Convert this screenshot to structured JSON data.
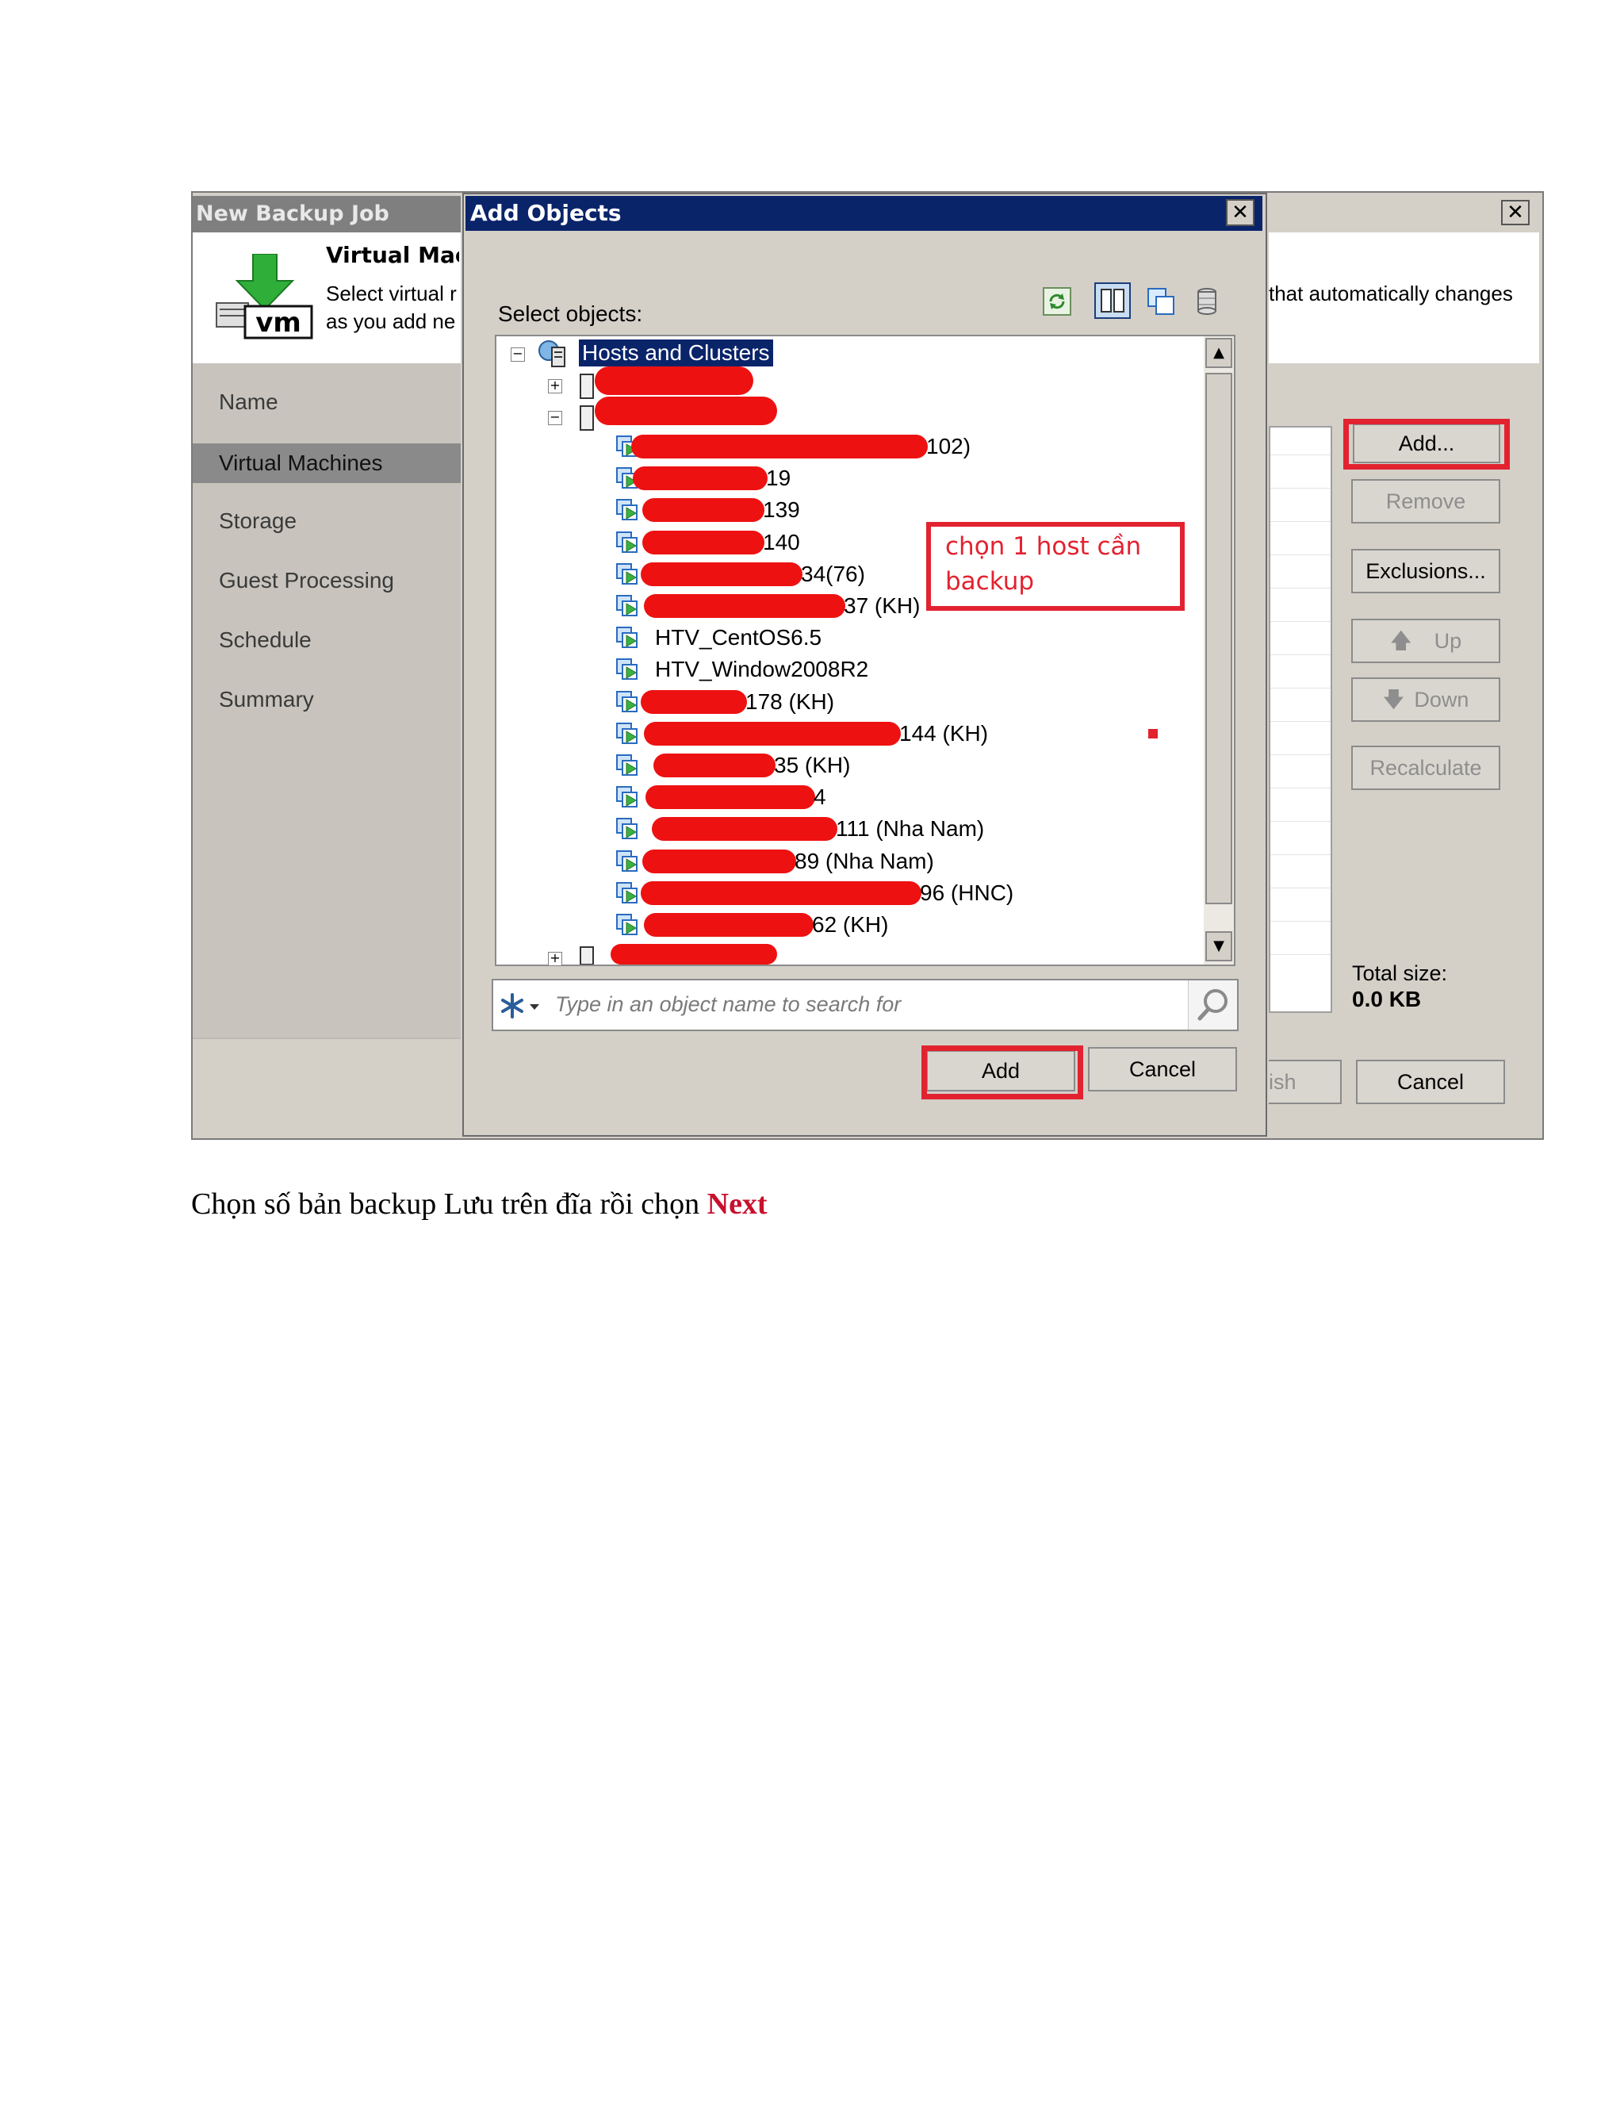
{
  "background_window": {
    "title": "New Backup Job",
    "header_title": "Virtual Mach",
    "header_desc_line1": "Select virtual r",
    "header_desc_line2": "as you add ne",
    "header_desc_right": "that automatically changes",
    "icon_text": "vm",
    "steps": [
      "Name",
      "Virtual Machines",
      "Storage",
      "Guest Processing",
      "Schedule",
      "Summary"
    ],
    "active_step": "Virtual Machines",
    "buttons": {
      "add": "Add...",
      "remove": "Remove",
      "exclusions": "Exclusions...",
      "up": "Up",
      "down": "Down",
      "recalculate": "Recalculate",
      "finish": "ish",
      "cancel": "Cancel"
    },
    "total_size_label": "Total size:",
    "total_size_value": "0.0 KB"
  },
  "dialog": {
    "title": "Add Objects",
    "select_label": "Select objects:",
    "tree_root": "Hosts and Clusters",
    "vm_items": [
      "102)",
      "19",
      "139",
      "140",
      "34(76)",
      "37 (KH)",
      "HTV_CentOS6.5",
      "HTV_Window2008R2",
      "178 (KH)",
      "144 (KH)",
      "35 (KH)",
      "4",
      "111 (Nha Nam)",
      "89 (Nha Nam)",
      "96 (HNC)",
      "62 (KH)"
    ],
    "annotation": "chọn 1 host cần backup",
    "search_placeholder": "Type in an object name to search for",
    "add_button": "Add",
    "cancel_button": "Cancel"
  },
  "caption": {
    "text": "Chọn số bản backup Lưu trên đĩa rồi chọn ",
    "emphasis": "Next"
  },
  "colors": {
    "highlight_red": "#e32230",
    "title_bar_blue": "#0a246a",
    "caption_next": "#c8102e"
  }
}
